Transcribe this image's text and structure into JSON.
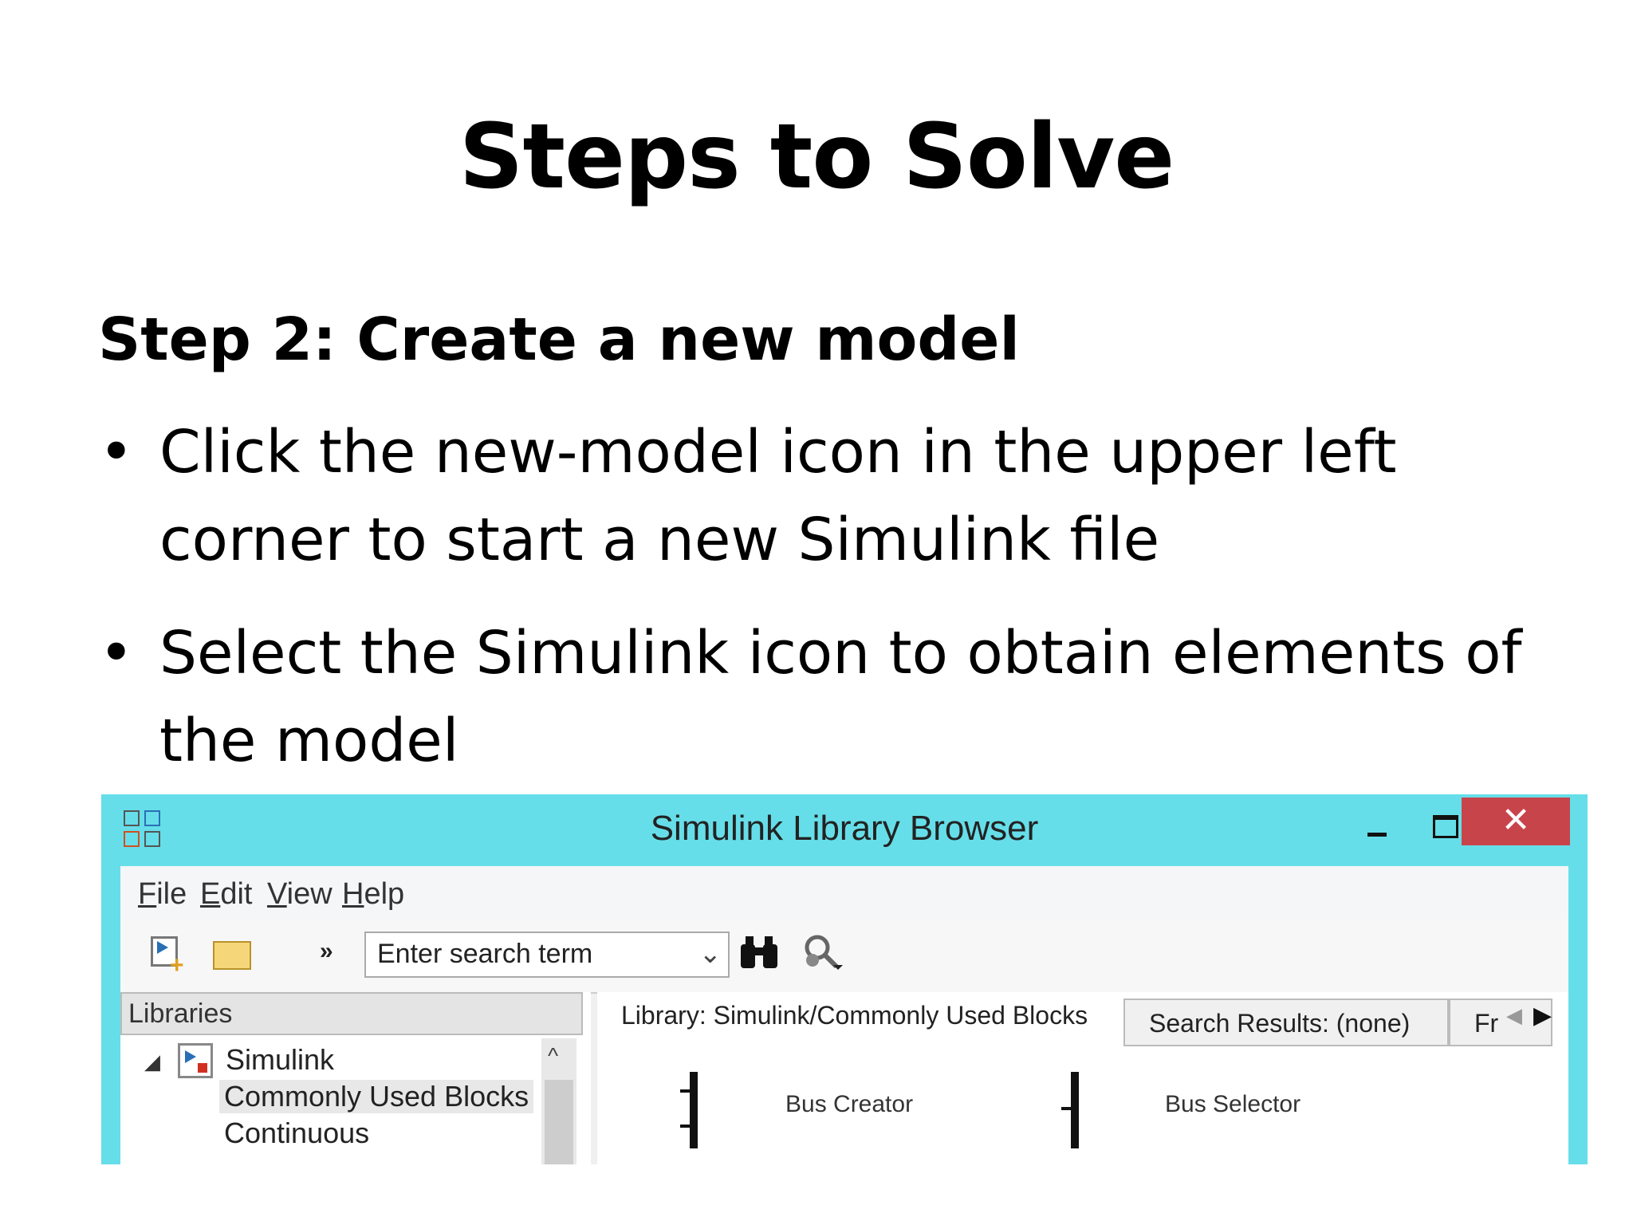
{
  "slide": {
    "title": "Steps to Solve",
    "heading": "Step 2: Create a new model",
    "bullets": [
      "Click the new-model icon in the upper left corner to start a new Simulink file",
      "Select the Simulink icon to obtain elements of the model"
    ]
  },
  "window": {
    "title": "Simulink Library Browser",
    "close_glyph": "✕"
  },
  "menu": {
    "items": [
      "File",
      "Edit",
      "View",
      "Help"
    ]
  },
  "toolbar": {
    "more": "»",
    "search_value": "",
    "search_placeholder": "Enter search term",
    "chevron": "⌄",
    "icons": [
      "new-model-icon",
      "open-folder-icon",
      "binoculars-icon",
      "search-options-icon"
    ]
  },
  "libraries": {
    "header": "Libraries",
    "expander": "◢",
    "items": [
      "Simulink",
      "Commonly Used Blocks",
      "Continuous"
    ],
    "scroll_up": "^"
  },
  "content": {
    "tabs": [
      "Library: Simulink/Commonly Used Blocks",
      "Search Results: (none)",
      "Fr"
    ],
    "blocks": [
      "Bus Creator",
      "Bus Selector"
    ]
  },
  "colors": {
    "window_frame": "#66dee9",
    "close_button": "#c8444b"
  }
}
